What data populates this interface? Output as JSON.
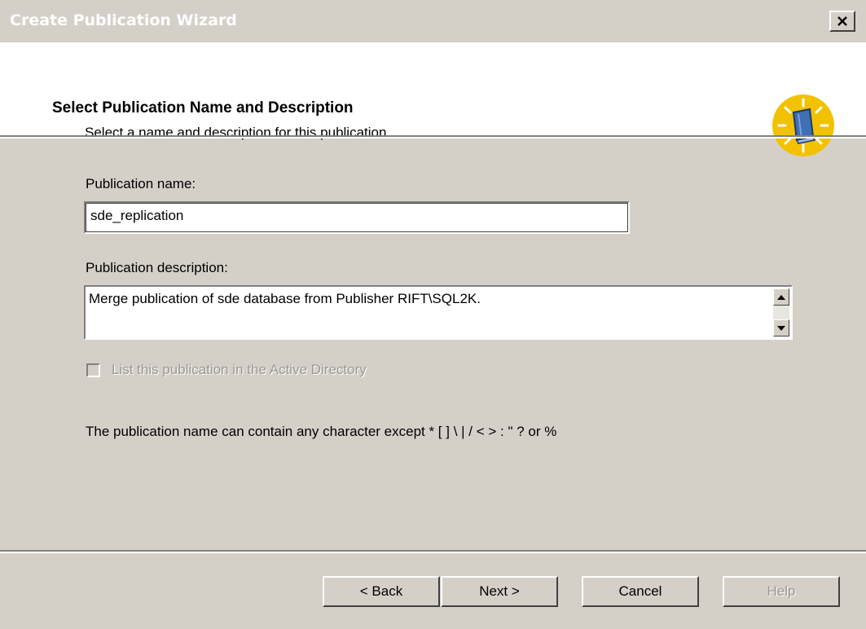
{
  "window": {
    "title": "Create Publication Wizard",
    "close_glyph": "✕"
  },
  "header": {
    "title": "Select Publication Name and Description",
    "subtitle": "Select a name and description for this publication.",
    "icon": "book-lightbulb-icon"
  },
  "form": {
    "name_label": "Publication name:",
    "name_value": "sde_replication",
    "description_label": "Publication description:",
    "description_value": "Merge publication of sde database from Publisher RIFT\\SQL2K.",
    "active_directory_label": "List this publication in the Active Directory",
    "active_directory_checked": false,
    "note": "The publication name can contain any character except * [ ] \\ | / < > : \" ? or %"
  },
  "buttons": {
    "back": "< Back",
    "next": "Next >",
    "cancel": "Cancel",
    "help": "Help"
  },
  "colors": {
    "dialog_bg": "#d4d0c8",
    "header_bg": "#ffffff",
    "disabled_text": "#9a9890",
    "icon_yellow": "#f2c200",
    "icon_blue": "#3f6fb5"
  }
}
